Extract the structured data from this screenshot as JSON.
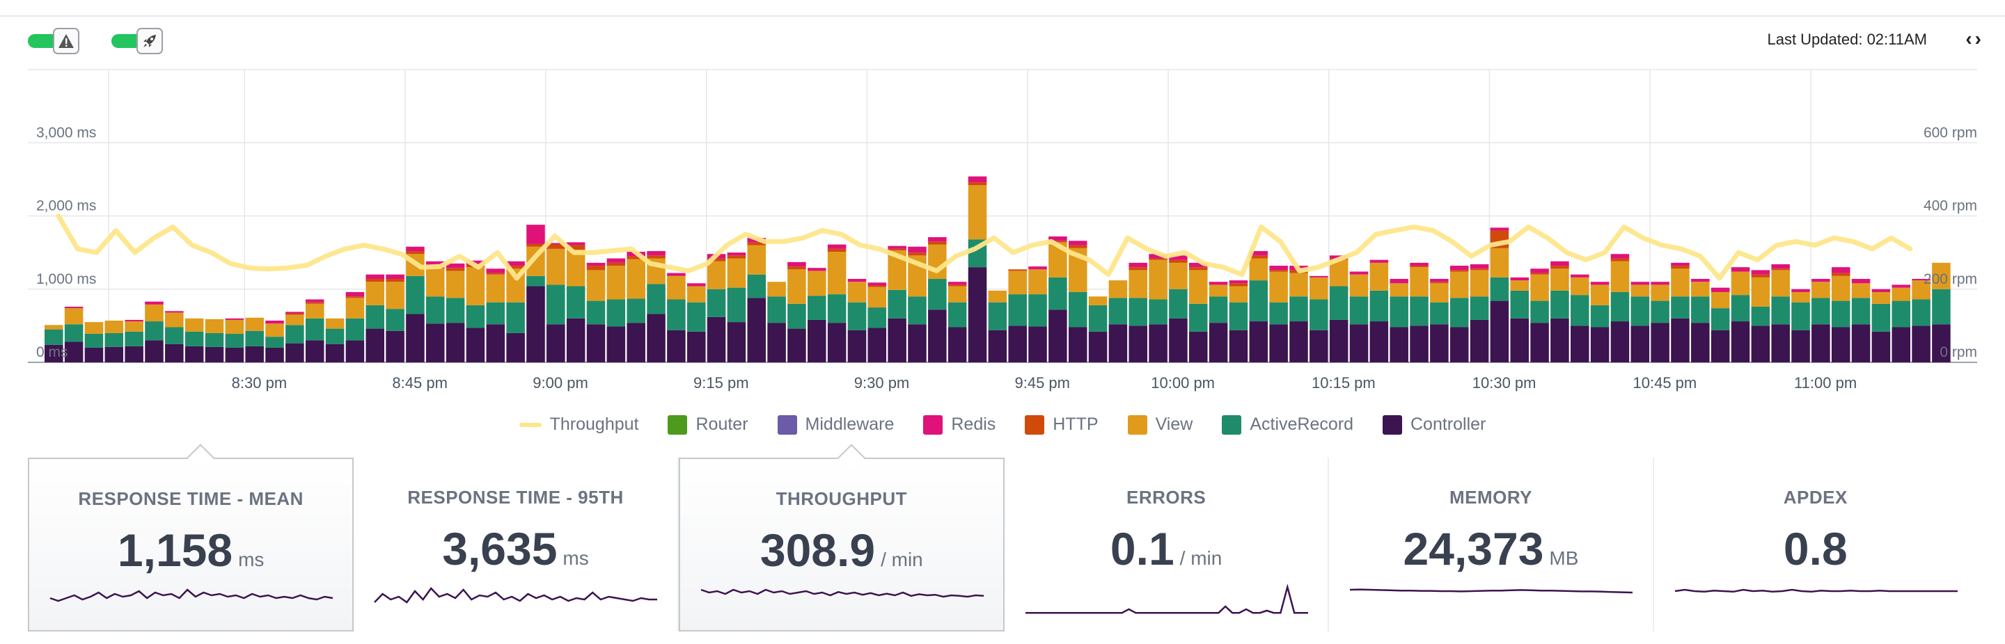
{
  "header": {
    "toggle_alerts_icon": "warning-triangle-icon",
    "toggle_deploys_icon": "rocket-icon",
    "last_updated": "Last Updated: 02:11AM",
    "nav_arrows": "‹›"
  },
  "legend": [
    {
      "name": "Throughput",
      "color": "#fde68a",
      "kind": "line"
    },
    {
      "name": "Router",
      "color": "#4d9a1c",
      "kind": "box"
    },
    {
      "name": "Middleware",
      "color": "#6b5ba8",
      "kind": "box"
    },
    {
      "name": "Redis",
      "color": "#e0127a",
      "kind": "box"
    },
    {
      "name": "HTTP",
      "color": "#d04a0c",
      "kind": "box"
    },
    {
      "name": "View",
      "color": "#e09b1c",
      "kind": "box"
    },
    {
      "name": "ActiveRecord",
      "color": "#1e8c6a",
      "kind": "box"
    },
    {
      "name": "Controller",
      "color": "#3c1450",
      "kind": "box"
    }
  ],
  "cards": [
    {
      "title": "RESPONSE TIME - MEAN",
      "value": "1,158",
      "unit": "ms",
      "active": true,
      "spark": [
        0.5,
        0.4,
        0.5,
        0.6,
        0.45,
        0.55,
        0.7,
        0.5,
        0.65,
        0.55,
        0.6,
        0.75,
        0.5,
        0.7,
        0.6,
        0.65,
        0.5,
        0.8,
        0.55,
        0.7,
        0.6,
        0.65,
        0.55,
        0.6,
        0.5,
        0.65,
        0.55,
        0.6,
        0.5,
        0.55,
        0.5,
        0.6,
        0.5,
        0.45,
        0.55,
        0.5
      ]
    },
    {
      "title": "RESPONSE TIME - 95TH",
      "value": "3,635",
      "unit": "ms",
      "active": false,
      "spark": [
        0.4,
        0.7,
        0.5,
        0.6,
        0.4,
        0.8,
        0.5,
        0.9,
        0.6,
        0.7,
        0.55,
        0.85,
        0.5,
        0.65,
        0.6,
        0.75,
        0.5,
        0.6,
        0.45,
        0.7,
        0.55,
        0.65,
        0.5,
        0.6,
        0.45,
        0.55,
        0.5,
        0.75,
        0.5,
        0.6,
        0.55,
        0.5,
        0.45,
        0.55,
        0.5,
        0.5
      ]
    },
    {
      "title": "THROUGHPUT",
      "value": "308.9",
      "unit": "/ min",
      "active": true,
      "spark": [
        0.8,
        0.7,
        0.75,
        0.65,
        0.8,
        0.7,
        0.75,
        0.65,
        0.8,
        0.7,
        0.75,
        0.65,
        0.7,
        0.75,
        0.65,
        0.7,
        0.6,
        0.72,
        0.65,
        0.7,
        0.62,
        0.68,
        0.6,
        0.66,
        0.6,
        0.7,
        0.58,
        0.64,
        0.6,
        0.62,
        0.55,
        0.6,
        0.58,
        0.55,
        0.6,
        0.58
      ]
    },
    {
      "title": "ERRORS",
      "value": "0.1",
      "unit": "/ min",
      "active": false,
      "spark": [
        0.02,
        0.02,
        0.02,
        0.02,
        0.02,
        0.02,
        0.02,
        0.02,
        0.02,
        0.02,
        0.02,
        0.02,
        0.02,
        0.02,
        0.02,
        0.15,
        0.02,
        0.02,
        0.02,
        0.02,
        0.02,
        0.02,
        0.02,
        0.02,
        0.02,
        0.02,
        0.02,
        0.02,
        0.02,
        0.25,
        0.02,
        0.02,
        0.15,
        0.02,
        0.02,
        0.1,
        0.02,
        0.02,
        0.95,
        0.02,
        0.02,
        0.02
      ]
    },
    {
      "title": "MEMORY",
      "value": "24,373",
      "unit": "MB",
      "active": false,
      "spark": [
        0.85,
        0.86,
        0.85,
        0.84,
        0.83,
        0.82,
        0.82,
        0.81,
        0.81,
        0.8,
        0.8,
        0.79,
        0.8,
        0.81,
        0.82,
        0.82,
        0.83,
        0.84,
        0.83,
        0.82,
        0.82,
        0.81,
        0.8,
        0.79,
        0.79,
        0.78,
        0.77,
        0.76,
        0.75
      ]
    },
    {
      "title": "APDEX",
      "value": "0.8",
      "unit": "",
      "active": false,
      "spark": [
        0.8,
        0.85,
        0.8,
        0.78,
        0.82,
        0.8,
        0.78,
        0.85,
        0.8,
        0.82,
        0.78,
        0.8,
        0.85,
        0.8,
        0.78,
        0.82,
        0.8,
        0.8,
        0.82,
        0.8,
        0.8,
        0.82,
        0.8,
        0.8,
        0.8,
        0.8,
        0.8,
        0.8,
        0.8,
        0.8
      ]
    }
  ],
  "chart_data": {
    "type": "bar",
    "stacked": true,
    "y_left": {
      "ticks": [
        "0 ms",
        "1,000 ms",
        "2,000 ms",
        "3,000 ms"
      ],
      "range": [
        0,
        4000
      ]
    },
    "y_right": {
      "ticks": [
        "0 rpm",
        "200 rpm",
        "400 rpm",
        "600 rpm"
      ],
      "range": [
        0,
        800
      ]
    },
    "x_ticks": [
      "8:30 pm",
      "8:45 pm",
      "9:00 pm",
      "9:15 pm",
      "9:30 pm",
      "9:45 pm",
      "10:00 pm",
      "10:15 pm",
      "10:30 pm",
      "10:45 pm",
      "11:00 pm"
    ],
    "x_tick_bar_index": [
      10,
      18,
      25,
      33,
      41,
      49,
      56,
      64,
      72,
      80,
      88
    ],
    "grid": true,
    "bar_series": [
      "Controller",
      "ActiveRecord",
      "View",
      "HTTP",
      "Redis"
    ],
    "bars": [
      [
        240,
        210,
        60,
        0,
        0
      ],
      [
        280,
        240,
        220,
        0,
        20
      ],
      [
        200,
        190,
        160,
        0,
        0
      ],
      [
        210,
        190,
        170,
        0,
        0
      ],
      [
        220,
        200,
        140,
        0,
        20
      ],
      [
        300,
        260,
        230,
        0,
        40
      ],
      [
        250,
        230,
        200,
        0,
        20
      ],
      [
        220,
        200,
        180,
        0,
        0
      ],
      [
        210,
        190,
        190,
        0,
        0
      ],
      [
        200,
        190,
        190,
        0,
        20
      ],
      [
        220,
        210,
        180,
        0,
        0
      ],
      [
        200,
        150,
        180,
        0,
        40
      ],
      [
        260,
        250,
        140,
        20,
        20
      ],
      [
        300,
        300,
        200,
        20,
        40
      ],
      [
        250,
        210,
        140,
        0,
        0
      ],
      [
        300,
        300,
        280,
        20,
        60
      ],
      [
        460,
        320,
        320,
        40,
        60
      ],
      [
        430,
        300,
        370,
        40,
        60
      ],
      [
        660,
        520,
        300,
        40,
        60
      ],
      [
        530,
        370,
        380,
        40,
        60
      ],
      [
        540,
        340,
        370,
        40,
        60
      ],
      [
        470,
        310,
        520,
        40,
        50
      ],
      [
        520,
        300,
        380,
        20,
        60
      ],
      [
        400,
        420,
        460,
        40,
        60
      ],
      [
        1040,
        140,
        400,
        40,
        260
      ],
      [
        520,
        540,
        490,
        60,
        20
      ],
      [
        600,
        440,
        500,
        60,
        40
      ],
      [
        520,
        320,
        420,
        60,
        40
      ],
      [
        490,
        370,
        460,
        40,
        60
      ],
      [
        540,
        330,
        540,
        40,
        60
      ],
      [
        660,
        410,
        350,
        40,
        60
      ],
      [
        440,
        420,
        320,
        0,
        40
      ],
      [
        420,
        400,
        220,
        0,
        40
      ],
      [
        620,
        380,
        380,
        40,
        60
      ],
      [
        550,
        470,
        400,
        40,
        40
      ],
      [
        880,
        320,
        400,
        40,
        60
      ],
      [
        540,
        360,
        200,
        0,
        0
      ],
      [
        460,
        340,
        470,
        40,
        60
      ],
      [
        580,
        330,
        340,
        0,
        40
      ],
      [
        540,
        390,
        580,
        40,
        60
      ],
      [
        440,
        380,
        280,
        0,
        40
      ],
      [
        470,
        280,
        280,
        20,
        40
      ],
      [
        600,
        390,
        540,
        20,
        40
      ],
      [
        520,
        380,
        560,
        40,
        80
      ],
      [
        720,
        420,
        470,
        40,
        60
      ],
      [
        480,
        340,
        220,
        20,
        40
      ],
      [
        1300,
        380,
        740,
        40,
        80
      ],
      [
        440,
        380,
        160,
        0,
        0
      ],
      [
        500,
        430,
        320,
        20,
        0
      ],
      [
        490,
        440,
        340,
        0,
        40
      ],
      [
        720,
        440,
        480,
        20,
        60
      ],
      [
        480,
        480,
        600,
        40,
        60
      ],
      [
        420,
        360,
        120,
        0,
        0
      ],
      [
        520,
        360,
        240,
        0,
        0
      ],
      [
        500,
        380,
        380,
        40,
        60
      ],
      [
        520,
        340,
        540,
        20,
        60
      ],
      [
        600,
        400,
        360,
        40,
        60
      ],
      [
        420,
        380,
        460,
        40,
        60
      ],
      [
        540,
        360,
        160,
        0,
        40
      ],
      [
        440,
        380,
        220,
        40,
        40
      ],
      [
        560,
        560,
        300,
        40,
        60
      ],
      [
        520,
        300,
        420,
        20,
        60
      ],
      [
        560,
        340,
        320,
        40,
        60
      ],
      [
        440,
        420,
        300,
        0,
        20
      ],
      [
        580,
        460,
        360,
        20,
        40
      ],
      [
        520,
        380,
        300,
        0,
        40
      ],
      [
        560,
        420,
        380,
        0,
        40
      ],
      [
        480,
        420,
        180,
        0,
        60
      ],
      [
        500,
        400,
        400,
        20,
        40
      ],
      [
        520,
        300,
        260,
        20,
        40
      ],
      [
        480,
        400,
        360,
        20,
        60
      ],
      [
        580,
        320,
        360,
        20,
        60
      ],
      [
        840,
        320,
        400,
        240,
        40
      ],
      [
        600,
        380,
        140,
        0,
        40
      ],
      [
        540,
        300,
        360,
        20,
        60
      ],
      [
        600,
        380,
        300,
        40,
        60
      ],
      [
        500,
        420,
        240,
        0,
        40
      ],
      [
        480,
        300,
        280,
        0,
        40
      ],
      [
        560,
        400,
        420,
        40,
        60
      ],
      [
        500,
        400,
        160,
        0,
        40
      ],
      [
        540,
        300,
        220,
        0,
        40
      ],
      [
        600,
        300,
        380,
        40,
        40
      ],
      [
        540,
        360,
        200,
        0,
        40
      ],
      [
        440,
        300,
        220,
        0,
        60
      ],
      [
        560,
        360,
        320,
        0,
        60
      ],
      [
        500,
        260,
        400,
        40,
        60
      ],
      [
        520,
        380,
        360,
        20,
        60
      ],
      [
        440,
        380,
        140,
        0,
        40
      ],
      [
        520,
        360,
        220,
        0,
        40
      ],
      [
        480,
        360,
        340,
        40,
        80
      ],
      [
        520,
        360,
        200,
        0,
        60
      ],
      [
        420,
        380,
        160,
        0,
        40
      ],
      [
        480,
        360,
        180,
        0,
        40
      ],
      [
        500,
        360,
        260,
        0,
        20
      ],
      [
        520,
        480,
        360,
        0,
        0
      ]
    ],
    "throughput": [
      400,
      310,
      300,
      360,
      300,
      340,
      370,
      320,
      300,
      270,
      258,
      255,
      258,
      265,
      290,
      310,
      320,
      310,
      295,
      260,
      262,
      290,
      260,
      300,
      230,
      290,
      345,
      300,
      300,
      305,
      310,
      270,
      260,
      250,
      270,
      320,
      350,
      330,
      330,
      340,
      360,
      350,
      320,
      310,
      290,
      270,
      250,
      290,
      310,
      340,
      300,
      320,
      330,
      300,
      280,
      240,
      340,
      310,
      290,
      300,
      270,
      260,
      240,
      370,
      330,
      250,
      260,
      280,
      300,
      350,
      360,
      370,
      360,
      330,
      290,
      320,
      330,
      370,
      340,
      300,
      280,
      300,
      370,
      340,
      320,
      310,
      290,
      230,
      300,
      280,
      320,
      330,
      320,
      340,
      330,
      310,
      340,
      310
    ]
  }
}
